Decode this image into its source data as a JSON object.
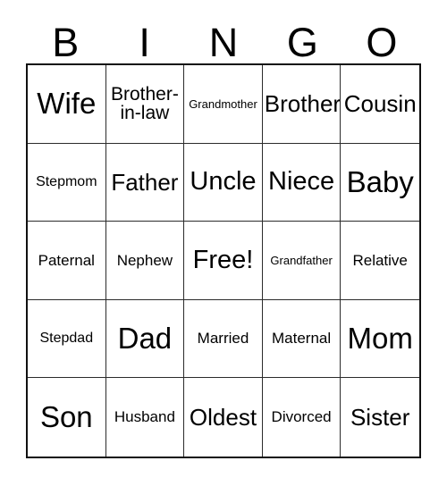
{
  "card": {
    "headers": [
      "B",
      "I",
      "N",
      "G",
      "O"
    ],
    "rows": [
      [
        {
          "label": "Wife",
          "size": "fs-xl"
        },
        {
          "label": "Brother-in-law",
          "size": "fs-sm"
        },
        {
          "label": "Grandmother",
          "size": "fs-tiny"
        },
        {
          "label": "Brother",
          "size": "fs-md"
        },
        {
          "label": "Cousin",
          "size": "fs-md"
        }
      ],
      [
        {
          "label": "Stepmom",
          "size": "fs-xxs"
        },
        {
          "label": "Father",
          "size": "fs-md"
        },
        {
          "label": "Uncle",
          "size": "fs-lg"
        },
        {
          "label": "Niece",
          "size": "fs-lg"
        },
        {
          "label": "Baby",
          "size": "fs-xl"
        }
      ],
      [
        {
          "label": "Paternal",
          "size": "fs-xs"
        },
        {
          "label": "Nephew",
          "size": "fs-xs"
        },
        {
          "label": "Free!",
          "size": "fs-lg"
        },
        {
          "label": "Grandfather",
          "size": "fs-tiny"
        },
        {
          "label": "Relative",
          "size": "fs-xs"
        }
      ],
      [
        {
          "label": "Stepdad",
          "size": "fs-xxs"
        },
        {
          "label": "Dad",
          "size": "fs-xl"
        },
        {
          "label": "Married",
          "size": "fs-xs"
        },
        {
          "label": "Maternal",
          "size": "fs-xs"
        },
        {
          "label": "Mom",
          "size": "fs-xl"
        }
      ],
      [
        {
          "label": "Son",
          "size": "fs-xl"
        },
        {
          "label": "Husband",
          "size": "fs-xs"
        },
        {
          "label": "Oldest",
          "size": "fs-md"
        },
        {
          "label": "Divorced",
          "size": "fs-xs"
        },
        {
          "label": "Sister",
          "size": "fs-md"
        }
      ]
    ],
    "free_space": "Free!",
    "colors": {
      "background": "#ffffff",
      "text": "#000000",
      "grid_line": "#2b2b2b",
      "outer_border": "#111111"
    }
  }
}
